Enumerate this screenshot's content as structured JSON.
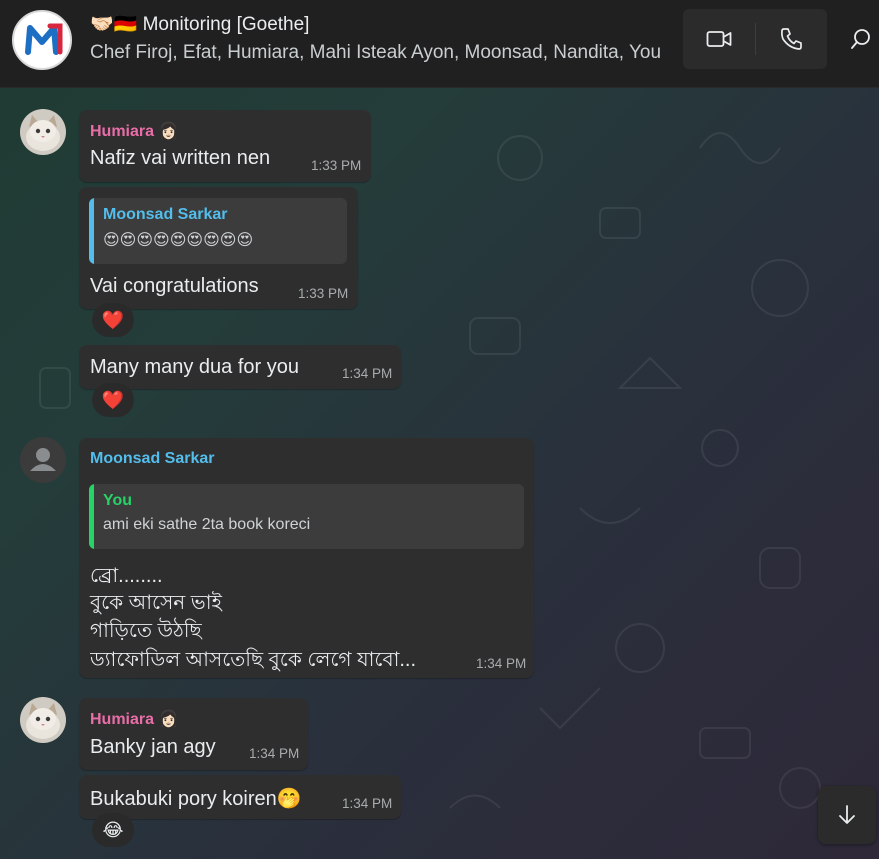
{
  "header": {
    "title": "🤝🏻🇩🇪 Monitoring [Goethe]",
    "members": "Chef Firoj, Efat, Humiara, Mahi Isteak Ayon, Moonsad, Nandita, You",
    "group_logo_letter": "M"
  },
  "colors": {
    "humiara": "#e86ea8",
    "moonsad": "#53bdeb",
    "you": "#25d366",
    "bubble": "#2e2e2e"
  },
  "messages": [
    {
      "sender": "Humiara 👩🏻",
      "text": "Nafiz vai written nen",
      "time": "1:33 PM"
    },
    {
      "quote_name": "Moonsad Sarkar",
      "quote_text": "😍😍😍😍😍😍😍😍😍",
      "text": "Vai congratulations",
      "time": "1:33 PM",
      "reaction": "❤️"
    },
    {
      "text": "Many many dua for you",
      "time": "1:34 PM",
      "reaction": "❤️"
    },
    {
      "sender": "Moonsad Sarkar",
      "quote_name": "You",
      "quote_text": "ami eki sathe 2ta book koreci",
      "lines": [
        "ব্রো........",
        "বুকে আসেন ভাই",
        "গাড়িতে উঠছি",
        "ড্যাফোডিল আসতেছি বুকে লেগে যাবো..."
      ],
      "time": "1:34 PM"
    },
    {
      "sender": "Humiara 👩🏻",
      "text": "Banky jan agy",
      "time": "1:34 PM"
    },
    {
      "text": "Bukabuki pory koiren🤭",
      "time": "1:34 PM",
      "reaction": "😂"
    }
  ]
}
